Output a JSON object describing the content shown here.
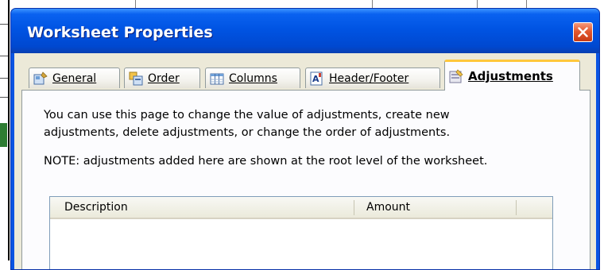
{
  "dialog": {
    "title": "Worksheet Properties",
    "close_tooltip": "Close"
  },
  "tabs": [
    {
      "label": "General",
      "icon": "general-icon",
      "active": false
    },
    {
      "label": "Order",
      "icon": "order-icon",
      "active": false
    },
    {
      "label": "Columns",
      "icon": "columns-icon",
      "active": false
    },
    {
      "label": "Header/Footer",
      "icon": "header-footer-icon",
      "active": false
    },
    {
      "label": "Adjustments",
      "icon": "adjustments-icon",
      "active": true
    }
  ],
  "panel": {
    "description_line1": "You can use this page to change the value of adjustments, create new",
    "description_line2": "adjustments, delete adjustments, or change the order of adjustments.",
    "note": "NOTE: adjustments added here are shown at the root level of the worksheet."
  },
  "adjustments_list": {
    "columns": [
      "Description",
      "Amount"
    ],
    "rows": []
  },
  "colors": {
    "titlebar": "#0054e3",
    "close_button": "#e3582f",
    "face": "#ece9d8",
    "active_tab_highlight": "#ffc73c"
  }
}
